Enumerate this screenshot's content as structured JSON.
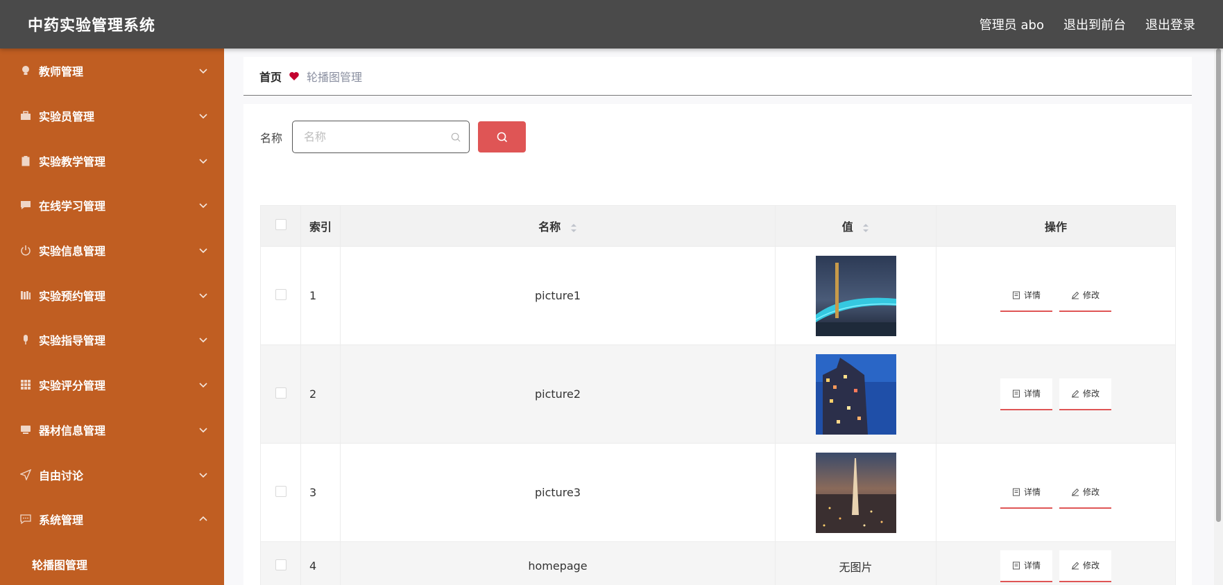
{
  "app": {
    "title": "中药实验管理系统"
  },
  "topbar": {
    "user": "管理员 abo",
    "front": "退出到前台",
    "logout": "退出登录"
  },
  "sidebar": {
    "items": [
      {
        "label": "教师管理",
        "icon": "lightbulb-icon"
      },
      {
        "label": "实验员管理",
        "icon": "briefcase-icon"
      },
      {
        "label": "实验教学管理",
        "icon": "clipboard-icon"
      },
      {
        "label": "在线学习管理",
        "icon": "chat-icon"
      },
      {
        "label": "实验信息管理",
        "icon": "power-icon"
      },
      {
        "label": "实验预约管理",
        "icon": "books-icon"
      },
      {
        "label": "实验指导管理",
        "icon": "microphone-icon"
      },
      {
        "label": "实验评分管理",
        "icon": "grid-icon"
      },
      {
        "label": "器材信息管理",
        "icon": "device-icon"
      },
      {
        "label": "自由讨论",
        "icon": "send-icon"
      },
      {
        "label": "系统管理",
        "icon": "message-icon"
      }
    ],
    "sub_item": "轮播图管理"
  },
  "breadcrumb": {
    "home": "首页",
    "current": "轮播图管理"
  },
  "search": {
    "label": "名称",
    "placeholder": "名称"
  },
  "table": {
    "headers": {
      "index": "索引",
      "name": "名称",
      "value": "值",
      "op": "操作"
    },
    "rows": [
      {
        "index": "1",
        "name": "picture1",
        "value": ""
      },
      {
        "index": "2",
        "name": "picture2",
        "value": ""
      },
      {
        "index": "3",
        "name": "picture3",
        "value": ""
      },
      {
        "index": "4",
        "name": "homepage",
        "value": "无图片"
      }
    ],
    "detail_label": "详情",
    "edit_label": "修改"
  },
  "colors": {
    "topbar": "#4a4a4a",
    "sidebar": "#c05e22",
    "accent": "#df5555"
  }
}
